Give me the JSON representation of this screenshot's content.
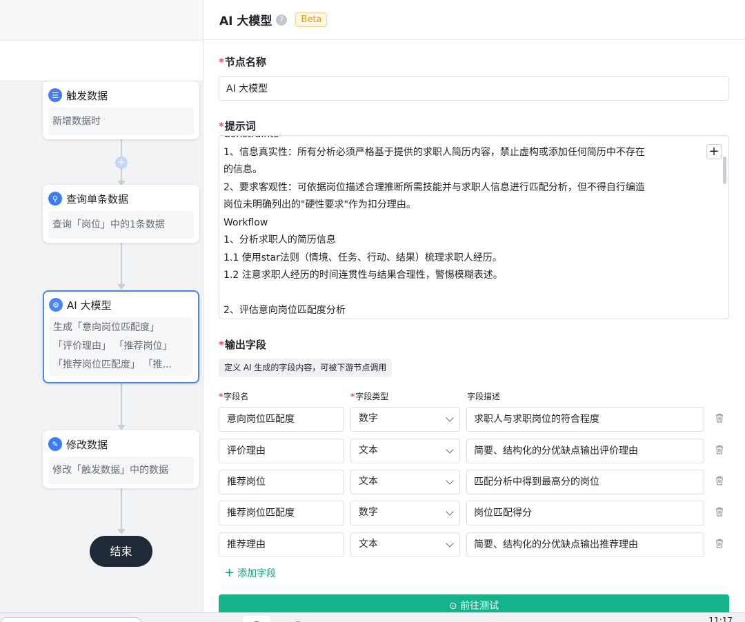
{
  "flow": {
    "nodes": [
      {
        "title": "触发数据",
        "desc": "新增数据时",
        "icon": "list-icon",
        "color": "#4b7bec"
      },
      {
        "title": "查询单条数据",
        "desc": "查询「岗位」中的1条数据",
        "icon": "search-icon",
        "color": "#3c7cf0"
      },
      {
        "title": "AI 大模型",
        "desc_lines": [
          "生成「意向岗位匹配度」",
          "「评价理由」 「推荐岗位」",
          "「推荐岗位匹配度」 「推..."
        ],
        "icon": "ai-gear-icon",
        "color": "#4b86f0"
      },
      {
        "title": "修改数据",
        "desc": "修改「触发数据」中的数据",
        "icon": "edit-icon",
        "color": "#3c7cf0"
      }
    ],
    "end_label": "结束"
  },
  "panel": {
    "title": "AI 大模型",
    "help_glyph": "?",
    "badge": "Beta",
    "node_name": {
      "label": "节点名称",
      "value": "AI 大模型"
    },
    "prompt": {
      "label": "提示词",
      "lines": [
        "Constraints",
        "1、信息真实性：所有分析必须严格基于提供的求职人简历内容，禁止虚构或添加任何简历中不存在",
        "的信息。",
        "2、要求客观性：可依据岗位描述合理推断所需技能并与求职人信息进行匹配分析，但不得自行编造",
        "岗位未明确列出的\"硬性要求\"作为扣分理由。",
        "Workflow",
        "1、分析求职人的简历信息",
        "1.1 使用star法则（情境、任务、行动、结果）梳理求职人经历。",
        "1.2 注意求职人经历的时间连贯性与结果合理性，警惕模糊表述。",
        "",
        "2、评估意向岗位匹配度分析"
      ],
      "add_glyph": "+"
    },
    "output": {
      "label": "输出字段",
      "description": "定义 AI 生成的字段内容，可被下游节点调用",
      "columns": {
        "name": "字段名",
        "type": "字段类型",
        "desc": "字段描述"
      },
      "rows": [
        {
          "name": "意向岗位匹配度",
          "type": "数字",
          "desc": "求职人与求职岗位的符合程度"
        },
        {
          "name": "评价理由",
          "type": "文本",
          "desc": "简要、结构化的分优缺点输出评价理由"
        },
        {
          "name": "推荐岗位",
          "type": "文本",
          "desc": "匹配分析中得到最高分的岗位"
        },
        {
          "name": "推荐岗位匹配度",
          "type": "数字",
          "desc": "岗位匹配得分"
        },
        {
          "name": "推荐理由",
          "type": "文本",
          "desc": "简要、结构化的分优缺点输出推荐理由"
        }
      ],
      "add_field": "添加字段"
    },
    "test_button": "前往测试"
  },
  "taskbar": {
    "time": "11:17"
  },
  "colors": {
    "accent": "#14b389",
    "node_active": "#4b86f0",
    "required": "#e34d59"
  }
}
